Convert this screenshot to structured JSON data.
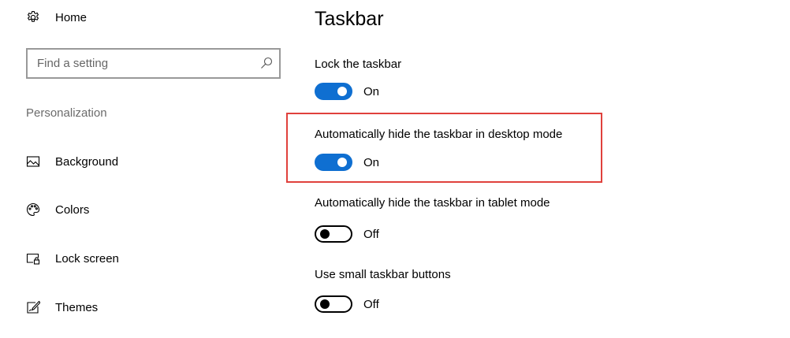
{
  "sidebar": {
    "home_label": "Home",
    "search": {
      "placeholder": "Find a setting",
      "value": ""
    },
    "section_label": "Personalization",
    "items": [
      {
        "label": "Background",
        "icon": "picture-icon"
      },
      {
        "label": "Colors",
        "icon": "palette-icon"
      },
      {
        "label": "Lock screen",
        "icon": "lock-screen-icon"
      },
      {
        "label": "Themes",
        "icon": "themes-icon"
      }
    ]
  },
  "main": {
    "title": "Taskbar",
    "settings": [
      {
        "label": "Lock the taskbar",
        "state": "On"
      },
      {
        "label": "Automatically hide the taskbar in desktop mode",
        "state": "On"
      },
      {
        "label": "Automatically hide the taskbar in tablet mode",
        "state": "Off"
      },
      {
        "label": "Use small taskbar buttons",
        "state": "Off"
      }
    ]
  },
  "colors": {
    "toggle_on": "#0f6fd1",
    "highlight": "#e0413c",
    "section_label": "#6b6b6b"
  }
}
